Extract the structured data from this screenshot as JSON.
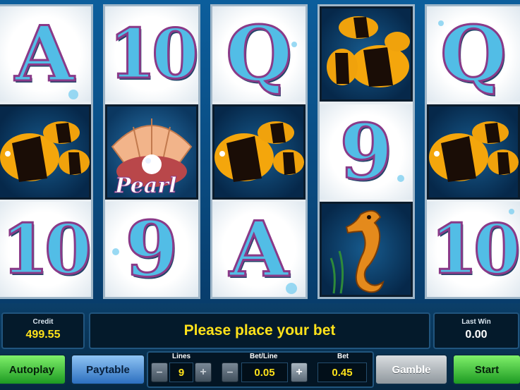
{
  "reels": [
    {
      "cells": [
        {
          "symbol": "A",
          "kind": "letter"
        },
        {
          "symbol": "tropical fish",
          "kind": "picture",
          "icon": "fish-icon"
        },
        {
          "symbol": "10",
          "kind": "letter"
        }
      ]
    },
    {
      "cells": [
        {
          "symbol": "10",
          "kind": "letter"
        },
        {
          "symbol": "Pearl",
          "kind": "picture",
          "icon": "pearl-shell-icon"
        },
        {
          "symbol": "9",
          "kind": "letter"
        }
      ]
    },
    {
      "cells": [
        {
          "symbol": "Q",
          "kind": "letter"
        },
        {
          "symbol": "tropical fish",
          "kind": "picture",
          "icon": "fish-icon"
        },
        {
          "symbol": "A",
          "kind": "letter"
        }
      ]
    },
    {
      "cells": [
        {
          "symbol": "tropical fish",
          "kind": "picture",
          "icon": "fish-icon"
        },
        {
          "symbol": "9",
          "kind": "letter"
        },
        {
          "symbol": "seahorse",
          "kind": "picture",
          "icon": "seahorse-icon"
        }
      ]
    },
    {
      "cells": [
        {
          "symbol": "Q",
          "kind": "letter"
        },
        {
          "symbol": "tropical fish",
          "kind": "picture",
          "icon": "fish-icon"
        },
        {
          "symbol": "10",
          "kind": "letter"
        }
      ]
    }
  ],
  "pearl_label": "Pearl",
  "credit": {
    "label": "Credit",
    "value": "499.55"
  },
  "message": "Please place your bet",
  "last_win": {
    "label": "Last Win",
    "value": "0.00"
  },
  "buttons": {
    "autoplay": "Autoplay",
    "paytable": "Paytable",
    "gamble": "Gamble",
    "start": "Start"
  },
  "lines": {
    "label": "Lines",
    "value": "9",
    "minus": "–",
    "plus": "+"
  },
  "bet_line": {
    "label": "Bet/Line",
    "value": "0.05",
    "minus": "–",
    "plus": "+"
  },
  "bet": {
    "label": "Bet",
    "value": "0.45"
  },
  "colors": {
    "symbol_fill": "#52bde6",
    "symbol_outline": "#8a3a88",
    "value_text": "#ffe21a",
    "start_green": "#1d9a22"
  }
}
